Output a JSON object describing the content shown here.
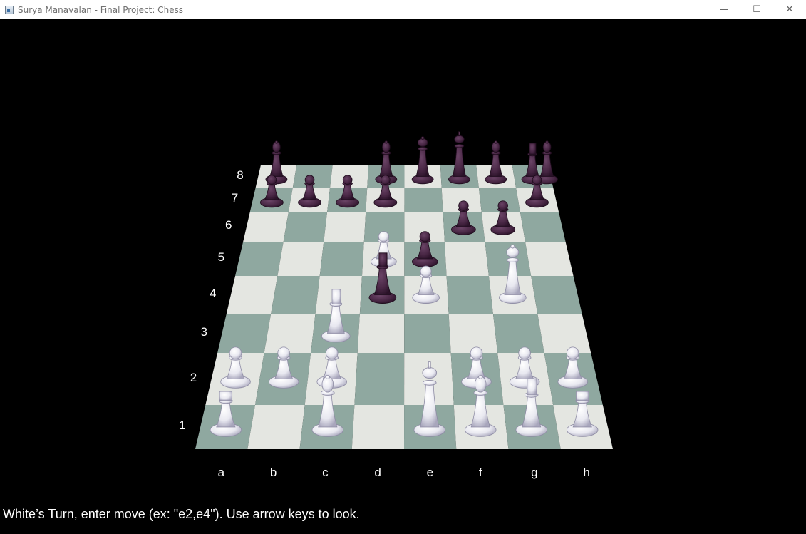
{
  "window": {
    "title": "Surya Manavalan - Final Project: Chess",
    "minimize_glyph": "—",
    "maximize_glyph": "☐",
    "close_glyph": "✕"
  },
  "colors": {
    "light_square": "#e4e6e1",
    "dark_square": "#8fa8a0",
    "white_piece": "#e8e8f0",
    "black_piece": "#4a2846",
    "background": "#000000"
  },
  "board": {
    "ranks": [
      "1",
      "2",
      "3",
      "4",
      "5",
      "6",
      "7",
      "8"
    ],
    "files": [
      "a",
      "b",
      "c",
      "d",
      "e",
      "f",
      "g",
      "h"
    ],
    "pieces": [
      {
        "square": "a8",
        "color": "black",
        "type": "bishop"
      },
      {
        "square": "d8",
        "color": "black",
        "type": "bishop"
      },
      {
        "square": "e8",
        "color": "black",
        "type": "queen"
      },
      {
        "square": "f8",
        "color": "black",
        "type": "king"
      },
      {
        "square": "g8",
        "color": "black",
        "type": "bishop"
      },
      {
        "square": "h8",
        "color": "black",
        "type": "knight"
      },
      {
        "square": "i8",
        "color": "black",
        "type": "bishop"
      },
      {
        "square": "a7",
        "color": "black",
        "type": "pawn"
      },
      {
        "square": "b7",
        "color": "black",
        "type": "pawn"
      },
      {
        "square": "c7",
        "color": "black",
        "type": "pawn"
      },
      {
        "square": "d7",
        "color": "black",
        "type": "pawn"
      },
      {
        "square": "h7",
        "color": "black",
        "type": "pawn"
      },
      {
        "square": "f6",
        "color": "black",
        "type": "pawn"
      },
      {
        "square": "g6",
        "color": "black",
        "type": "pawn"
      },
      {
        "square": "e5",
        "color": "black",
        "type": "pawn"
      },
      {
        "square": "d4",
        "color": "black",
        "type": "knight"
      },
      {
        "square": "d5",
        "color": "white",
        "type": "pawn"
      },
      {
        "square": "e4",
        "color": "white",
        "type": "pawn"
      },
      {
        "square": "g4",
        "color": "white",
        "type": "queen"
      },
      {
        "square": "c3",
        "color": "white",
        "type": "knight"
      },
      {
        "square": "a2",
        "color": "white",
        "type": "pawn"
      },
      {
        "square": "b2",
        "color": "white",
        "type": "pawn"
      },
      {
        "square": "c2",
        "color": "white",
        "type": "pawn"
      },
      {
        "square": "f2",
        "color": "white",
        "type": "pawn"
      },
      {
        "square": "g2",
        "color": "white",
        "type": "pawn"
      },
      {
        "square": "h2",
        "color": "white",
        "type": "pawn"
      },
      {
        "square": "a1",
        "color": "white",
        "type": "rook"
      },
      {
        "square": "c1",
        "color": "white",
        "type": "bishop"
      },
      {
        "square": "e1",
        "color": "white",
        "type": "king"
      },
      {
        "square": "f1",
        "color": "white",
        "type": "bishop"
      },
      {
        "square": "g1",
        "color": "white",
        "type": "knight"
      },
      {
        "square": "h1",
        "color": "white",
        "type": "rook"
      }
    ]
  },
  "status": {
    "message": "White’s Turn, enter move (ex: \"e2,e4\"). Use arrow keys to look."
  }
}
